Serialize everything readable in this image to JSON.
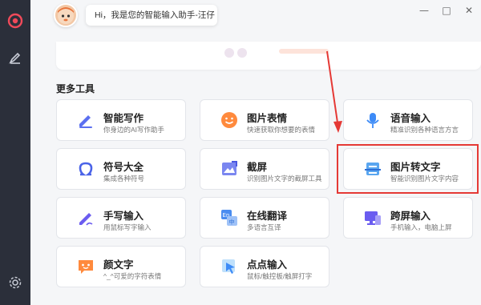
{
  "assistant": {
    "greeting": "Hi，我是您的智能输入助手-汪仔"
  },
  "window_controls": {
    "minimize": "—",
    "maximize": "□",
    "close": "✕"
  },
  "section": {
    "title": "更多工具"
  },
  "tools": [
    {
      "name": "智能写作",
      "desc": "你身边的AI写作助手",
      "icon": "pen-icon",
      "color": "#5b6ff0"
    },
    {
      "name": "图片表情",
      "desc": "快速获取你想要的表情",
      "icon": "smile-icon",
      "color": "#ff8a3d"
    },
    {
      "name": "语音输入",
      "desc": "精准识别各种语言方言",
      "icon": "mic-icon",
      "color": "#3d8bf7"
    },
    {
      "name": "符号大全",
      "desc": "集成各种符号",
      "icon": "omega-icon",
      "color": "#4a63e8"
    },
    {
      "name": "截屏",
      "desc": "识别图片文字的截屏工具",
      "icon": "screenshot-icon",
      "color": "#5b6ff0"
    },
    {
      "name": "图片转文字",
      "desc": "智能识别图片文字内容",
      "icon": "scan-text-icon",
      "color": "#4aa3f0"
    },
    {
      "name": "手写输入",
      "desc": "用鼠标写字输入",
      "icon": "handwrite-icon",
      "color": "#6b5cf0"
    },
    {
      "name": "在线翻译",
      "desc": "多语言互译",
      "icon": "translate-icon",
      "color": "#4a8cf0"
    },
    {
      "name": "跨屏输入",
      "desc": "手机输入，电脑上屏",
      "icon": "monitor-icon",
      "color": "#6a5cf0"
    },
    {
      "name": "颜文字",
      "desc": "^_^可爱的字符表情",
      "icon": "kaomoji-icon",
      "color": "#ff8a3d"
    },
    {
      "name": "点点输入",
      "desc": "鼠标/触控板/触屏打字",
      "icon": "cursor-icon",
      "color": "#3d8bf7"
    }
  ],
  "colors": {
    "sidebar": "#2b2f3a",
    "highlight": "#e53935",
    "background": "#f5f6f8"
  }
}
